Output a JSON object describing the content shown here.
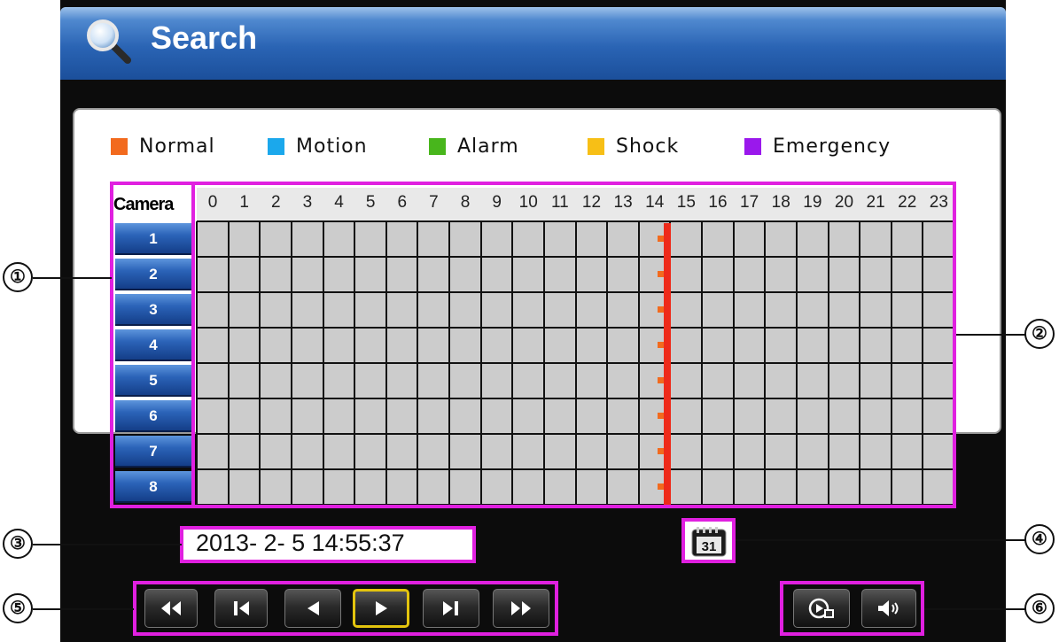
{
  "window": {
    "title": "Search"
  },
  "legend": [
    {
      "label": "Normal",
      "color": "#f26a1e"
    },
    {
      "label": "Motion",
      "color": "#1ba8ec"
    },
    {
      "label": "Alarm",
      "color": "#48b61c"
    },
    {
      "label": "Shock",
      "color": "#f7bf16"
    },
    {
      "label": "Emergency",
      "color": "#9a18ec"
    }
  ],
  "timeline": {
    "camera_header": "Camera",
    "hours": [
      "0",
      "1",
      "2",
      "3",
      "4",
      "5",
      "6",
      "7",
      "8",
      "9",
      "10",
      "11",
      "12",
      "13",
      "14",
      "15",
      "16",
      "17",
      "18",
      "19",
      "20",
      "21",
      "22",
      "23"
    ],
    "cameras": [
      "1",
      "2",
      "3",
      "4",
      "5",
      "6",
      "7",
      "8"
    ],
    "current_hour_marker": 14.9,
    "recording_type_color": "#f26a1e",
    "marker_color": "#ee2a1a"
  },
  "datetime": {
    "value": "2013- 2- 5 14:55:37"
  },
  "calendar": {
    "icon": "calendar-icon",
    "day": "31"
  },
  "playback_controls": [
    {
      "name": "fast-rewind-button",
      "icon": "fast-rewind-icon"
    },
    {
      "name": "previous-button",
      "icon": "skip-previous-icon"
    },
    {
      "name": "reverse-play-button",
      "icon": "reverse-play-icon"
    },
    {
      "name": "play-button",
      "icon": "play-icon",
      "active": true
    },
    {
      "name": "next-frame-button",
      "icon": "skip-next-icon"
    },
    {
      "name": "fast-forward-button",
      "icon": "fast-forward-icon"
    }
  ],
  "extra_controls": [
    {
      "name": "playback-mode-button",
      "icon": "playback-mode-icon"
    },
    {
      "name": "audio-button",
      "icon": "speaker-icon"
    }
  ],
  "callouts": [
    "①",
    "②",
    "③",
    "④",
    "⑤",
    "⑥"
  ]
}
